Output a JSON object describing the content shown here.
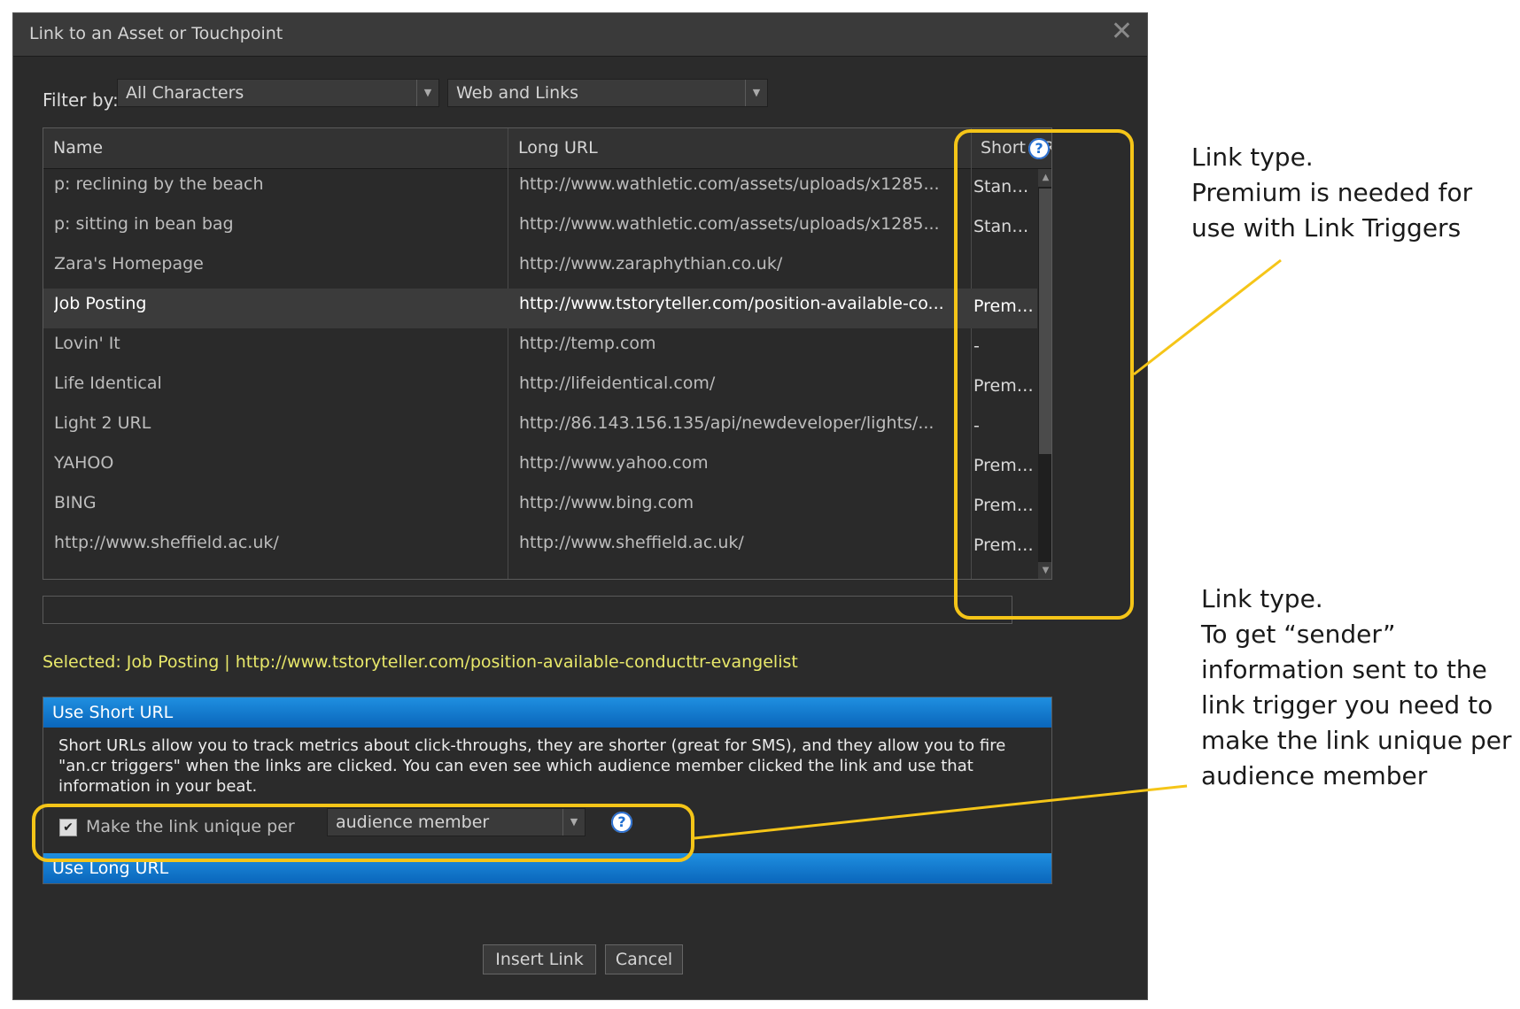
{
  "dialog": {
    "title": "Link to an Asset or Touchpoint",
    "close_glyph": "✕",
    "filter_label": "Filter by:",
    "filter_characters": "All Characters",
    "filter_type": "Web and Links"
  },
  "table": {
    "columns": [
      "Name",
      "Long URL",
      "Short URL"
    ],
    "rows": [
      {
        "name": "p: reclining by the beach",
        "long_url": "http://www.wathletic.com/assets/uploads/x1285...",
        "short_url": "Standard"
      },
      {
        "name": "p: sitting in bean bag",
        "long_url": "http://www.wathletic.com/assets/uploads/x1285...",
        "short_url": "Standard"
      },
      {
        "name": "Zara's Homepage",
        "long_url": "http://www.zaraphythian.co.uk/",
        "short_url": ""
      },
      {
        "name": "Job Posting",
        "long_url": "http://www.tstoryteller.com/position-available-co...",
        "short_url": "Premium"
      },
      {
        "name": "Lovin' It",
        "long_url": "http://temp.com",
        "short_url": "-"
      },
      {
        "name": "Life Identical",
        "long_url": "http://lifeidentical.com/",
        "short_url": "Premium"
      },
      {
        "name": "Light 2 URL",
        "long_url": "http://86.143.156.135/api/newdeveloper/lights/...",
        "short_url": "-"
      },
      {
        "name": "YAHOO",
        "long_url": "http://www.yahoo.com",
        "short_url": "Premium"
      },
      {
        "name": "BING",
        "long_url": "http://www.bing.com",
        "short_url": "Premium"
      },
      {
        "name": "http://www.sheffield.ac.uk/",
        "long_url": "http://www.sheffield.ac.uk/",
        "short_url": "Premium"
      }
    ]
  },
  "selected_text": "Selected: Job Posting | http://www.tstoryteller.com/position-available-conducttr-evangelist",
  "short_url_panel": {
    "header": "Use Short URL",
    "description": "Short URLs allow you to track metrics about click-throughs, they are shorter (great for SMS), and they allow you to fire \"an.cr triggers\" when the links are clicked. You can even see which audience member clicked the link and use that information in your beat.",
    "unique_label": "Make the link unique per",
    "unique_option": "audience member",
    "checked_glyph": "✔",
    "long_url_header": "Use Long URL"
  },
  "buttons": {
    "insert": "Insert Link",
    "cancel": "Cancel"
  },
  "annotations": {
    "top": [
      "Link type.",
      "Premium is needed for",
      "use with Link Triggers"
    ],
    "bottom": [
      "Link type.",
      "To get “sender”",
      "information sent to the",
      "link trigger you need to",
      "make the link unique per",
      "audience member"
    ]
  },
  "colors": {
    "highlight": "#f5c518",
    "panel_bar": "#1f8fe0",
    "selected_text": "#e8e86a"
  }
}
